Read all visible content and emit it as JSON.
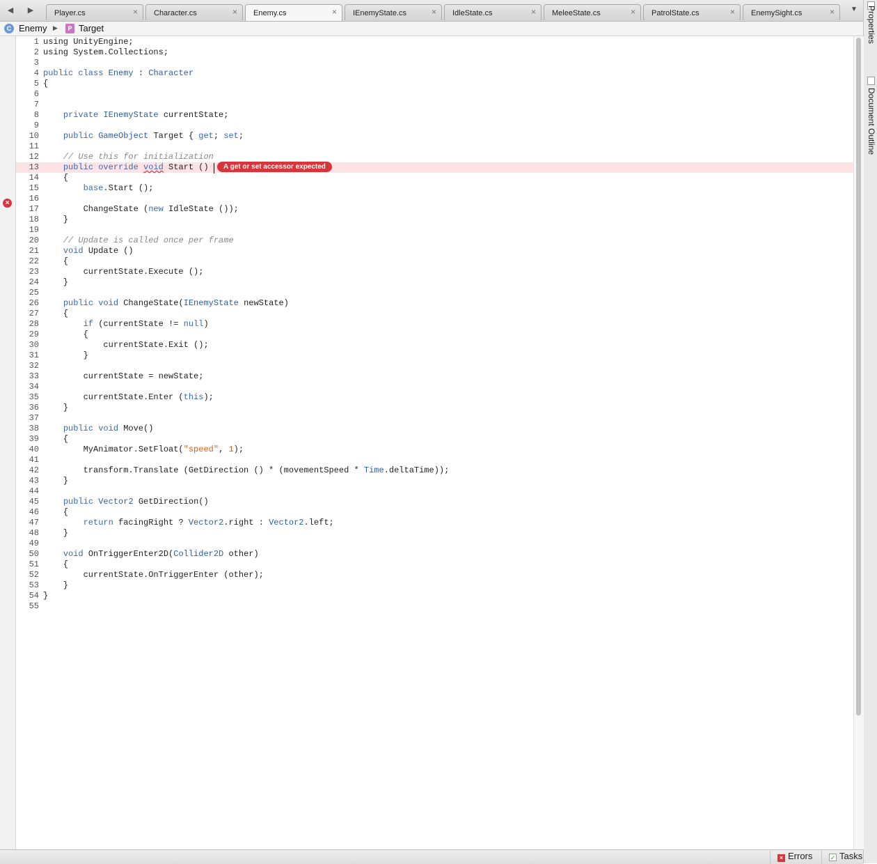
{
  "nav": {
    "back_icon": "◀",
    "forward_icon": "▶"
  },
  "tabs": [
    {
      "label": "Player.cs",
      "active": false
    },
    {
      "label": "Character.cs",
      "active": false
    },
    {
      "label": "Enemy.cs",
      "active": true
    },
    {
      "label": "IEnemyState.cs",
      "active": false
    },
    {
      "label": "IdleState.cs",
      "active": false
    },
    {
      "label": "MeleeState.cs",
      "active": false
    },
    {
      "label": "PatrolState.cs",
      "active": false
    },
    {
      "label": "EnemySight.cs",
      "active": false
    }
  ],
  "tab_close_glyph": "×",
  "tab_overflow_icon": "▼",
  "dock": {
    "properties": "Properties",
    "document_outline": "Document Outline"
  },
  "breadcrumb": {
    "class_icon": "C",
    "class_name": "Enemy",
    "separator": "▶",
    "member_icon": "P",
    "member_name": "Target"
  },
  "editor": {
    "error_line": 13,
    "error_message": "A get or set accessor expected",
    "error_marker_glyph": "×",
    "lines": [
      [
        [
          "p",
          "using UnityEngine;"
        ]
      ],
      [
        [
          "p",
          "using System.Collections;"
        ]
      ],
      [],
      [
        [
          "k",
          "public class "
        ],
        [
          "t",
          "Enemy"
        ],
        [
          "p",
          " : "
        ],
        [
          "t",
          "Character"
        ]
      ],
      [
        [
          "p",
          "{"
        ]
      ],
      [],
      [],
      [
        [
          "p",
          "    "
        ],
        [
          "k",
          "private "
        ],
        [
          "t",
          "IEnemyState"
        ],
        [
          "p",
          " currentState;"
        ]
      ],
      [],
      [
        [
          "p",
          "    "
        ],
        [
          "k",
          "public "
        ],
        [
          "t",
          "GameObject"
        ],
        [
          "p",
          " Target { "
        ],
        [
          "k",
          "get"
        ],
        [
          "p",
          "; "
        ],
        [
          "k",
          "set"
        ],
        [
          "p",
          ";"
        ]
      ],
      [],
      [
        [
          "p",
          "    "
        ],
        [
          "c",
          "// Use this for initialization"
        ]
      ],
      [
        [
          "p",
          "    "
        ],
        [
          "k",
          "public override "
        ],
        [
          "u",
          "void"
        ],
        [
          "p",
          " Start () "
        ]
      ],
      [
        [
          "p",
          "    {"
        ]
      ],
      [
        [
          "p",
          "        "
        ],
        [
          "k",
          "base"
        ],
        [
          "p",
          ".Start ();"
        ]
      ],
      [],
      [
        [
          "p",
          "        ChangeState ("
        ],
        [
          "k",
          "new"
        ],
        [
          "p",
          " IdleState ());"
        ]
      ],
      [
        [
          "p",
          "    }"
        ]
      ],
      [],
      [
        [
          "p",
          "    "
        ],
        [
          "c",
          "// Update is called once per frame"
        ]
      ],
      [
        [
          "p",
          "    "
        ],
        [
          "k",
          "void"
        ],
        [
          "p",
          " Update ()"
        ]
      ],
      [
        [
          "p",
          "    {"
        ]
      ],
      [
        [
          "p",
          "        currentState.Execute ();"
        ]
      ],
      [
        [
          "p",
          "    }"
        ]
      ],
      [],
      [
        [
          "p",
          "    "
        ],
        [
          "k",
          "public void"
        ],
        [
          "p",
          " ChangeState("
        ],
        [
          "t",
          "IEnemyState"
        ],
        [
          "p",
          " newState)"
        ]
      ],
      [
        [
          "p",
          "    {"
        ]
      ],
      [
        [
          "p",
          "        "
        ],
        [
          "k",
          "if"
        ],
        [
          "p",
          " (currentState != "
        ],
        [
          "k",
          "null"
        ],
        [
          "p",
          ")"
        ]
      ],
      [
        [
          "p",
          "        {"
        ]
      ],
      [
        [
          "p",
          "            currentState.Exit ();"
        ]
      ],
      [
        [
          "p",
          "        }"
        ]
      ],
      [],
      [
        [
          "p",
          "        currentState = newState;"
        ]
      ],
      [],
      [
        [
          "p",
          "        currentState.Enter ("
        ],
        [
          "k",
          "this"
        ],
        [
          "p",
          ");"
        ]
      ],
      [
        [
          "p",
          "    }"
        ]
      ],
      [],
      [
        [
          "p",
          "    "
        ],
        [
          "k",
          "public void"
        ],
        [
          "p",
          " Move()"
        ]
      ],
      [
        [
          "p",
          "    {"
        ]
      ],
      [
        [
          "p",
          "        MyAnimator.SetFloat("
        ],
        [
          "s",
          "\"speed\""
        ],
        [
          "p",
          ", "
        ],
        [
          "n",
          "1"
        ],
        [
          "p",
          ");"
        ]
      ],
      [],
      [
        [
          "p",
          "        transform.Translate (GetDirection () * (movementSpeed * "
        ],
        [
          "t",
          "Time"
        ],
        [
          "p",
          ".deltaTime));"
        ]
      ],
      [
        [
          "p",
          "    }"
        ]
      ],
      [],
      [
        [
          "p",
          "    "
        ],
        [
          "k",
          "public "
        ],
        [
          "t",
          "Vector2"
        ],
        [
          "p",
          " GetDirection()"
        ]
      ],
      [
        [
          "p",
          "    {"
        ]
      ],
      [
        [
          "p",
          "        "
        ],
        [
          "k",
          "return"
        ],
        [
          "p",
          " facingRight ? "
        ],
        [
          "t",
          "Vector2"
        ],
        [
          "p",
          ".right : "
        ],
        [
          "t",
          "Vector2"
        ],
        [
          "p",
          ".left;"
        ]
      ],
      [
        [
          "p",
          "    }"
        ]
      ],
      [],
      [
        [
          "p",
          "    "
        ],
        [
          "k",
          "void"
        ],
        [
          "p",
          " OnTriggerEnter2D("
        ],
        [
          "t",
          "Collider2D"
        ],
        [
          "p",
          " other)"
        ]
      ],
      [
        [
          "p",
          "    {"
        ]
      ],
      [
        [
          "p",
          "        currentState.OnTriggerEnter (other);"
        ]
      ],
      [
        [
          "p",
          "    }"
        ]
      ],
      [
        [
          "p",
          "}"
        ]
      ],
      []
    ]
  },
  "statusbar": {
    "errors_label": "Errors",
    "errors_icon": "×",
    "tasks_label": "Tasks",
    "tasks_icon": "✓"
  },
  "colors": {
    "keyword": "#3d6ab0",
    "type": "#2f5f9e",
    "comment": "#888888",
    "string": "#e0601c",
    "error": "#d8343c",
    "error_line_bg": "#fde3e6"
  }
}
